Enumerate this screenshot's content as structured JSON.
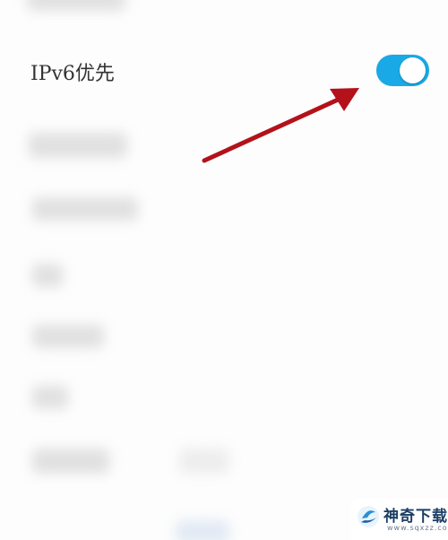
{
  "setting": {
    "label": "IPv6优先",
    "toggle_state": "on"
  },
  "colors": {
    "toggle_on": "#18a9e6",
    "arrow": "#b3121a"
  },
  "watermark": {
    "title": "神奇下载",
    "url": "www.sqxzz.com"
  }
}
